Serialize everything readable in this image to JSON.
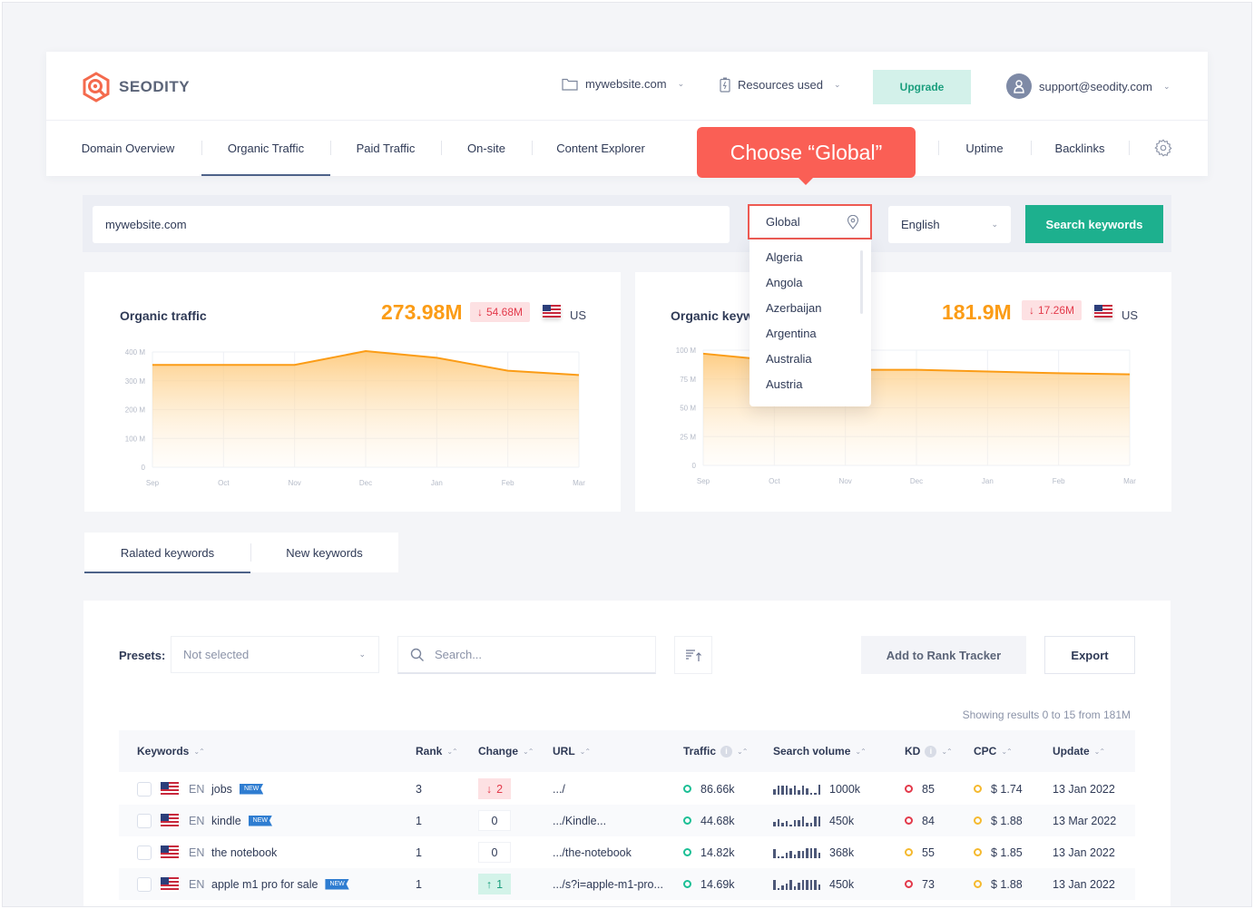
{
  "header": {
    "brand": "SEODITY",
    "project": "mywebsite.com",
    "resources": "Resources used",
    "upgrade": "Upgrade",
    "user_email": "support@seodity.com"
  },
  "nav": {
    "items": [
      {
        "label": "Domain Overview",
        "active": false
      },
      {
        "label": "Organic Traffic",
        "active": true
      },
      {
        "label": "Paid Traffic",
        "active": false
      },
      {
        "label": "On-site",
        "active": false
      },
      {
        "label": "Content Explorer",
        "active": false
      },
      {
        "label": "Uptime",
        "active": false
      },
      {
        "label": "Backlinks",
        "active": false
      }
    ]
  },
  "callout": "Choose “Global”",
  "search": {
    "domain_value": "mywebsite.com",
    "location_value": "Global",
    "language_value": "English",
    "submit_label": "Search keywords",
    "location_options": [
      "Algeria",
      "Angola",
      "Azerbaijan",
      "Argentina",
      "Australia",
      "Austria"
    ]
  },
  "colors": {
    "accent_orange": "#fb9c16",
    "brand_green": "#1db08e",
    "callout_red": "#fa5f55",
    "negative": "#e3394a",
    "positive": "#1a9e7d"
  },
  "chart_data": [
    {
      "type": "area",
      "title": "Organic traffic",
      "summary_value": "273.98M",
      "delta": "54.68M",
      "delta_direction": "down",
      "country": "US",
      "categories": [
        "Sep",
        "Oct",
        "Nov",
        "Dec",
        "Jan",
        "Feb",
        "Mar"
      ],
      "values": [
        355,
        355,
        355,
        403,
        380,
        335,
        320
      ],
      "unit": "M",
      "ylim": [
        0,
        400
      ],
      "yticks": [
        "0",
        "100 M",
        "200 M",
        "300 M",
        "400 M"
      ],
      "grid": true
    },
    {
      "type": "area",
      "title": "Organic keywords",
      "summary_value": "181.9M",
      "delta": "17.26M",
      "delta_direction": "down",
      "country": "US",
      "categories": [
        "Sep",
        "Oct",
        "Nov",
        "Dec",
        "Jan",
        "Feb",
        "Mar"
      ],
      "values": [
        97,
        91,
        83,
        83,
        81.5,
        80,
        79
      ],
      "unit": "M",
      "ylim": [
        0,
        100
      ],
      "yticks": [
        "0",
        "25 M",
        "50 M",
        "75 M",
        "100 M"
      ],
      "grid": true
    }
  ],
  "tabs": [
    {
      "label": "Ralated keywords",
      "active": true
    },
    {
      "label": "New keywords",
      "active": false
    }
  ],
  "table_controls": {
    "presets_label": "Presets:",
    "presets_value": "Not selected",
    "search_placeholder": "Search...",
    "add_rank_tracker": "Add to Rank Tracker",
    "export": "Export",
    "showing": "Showing results 0 to 15 from 181M"
  },
  "table": {
    "columns": [
      "Keywords",
      "Rank",
      "Change",
      "URL",
      "Traffic",
      "Search volume",
      "KD",
      "CPC",
      "Update"
    ],
    "rows": [
      {
        "lang": "EN",
        "keyword": "jobs",
        "is_new": true,
        "new_label": "NEW",
        "rank": "3",
        "change": "2",
        "change_dir": "down",
        "url": ".../",
        "traffic": "86.66k",
        "volume": "1000k",
        "volume_trend": [
          0.5,
          0.8,
          0.8,
          0.8,
          0.6,
          0.8,
          0.4,
          0.8,
          0.6,
          0.2,
          0.2,
          0.9
        ],
        "kd": "85",
        "kd_level": "high",
        "cpc": "$ 1.74",
        "update": "13 Jan 2022"
      },
      {
        "lang": "EN",
        "keyword": "kindle",
        "is_new": true,
        "new_label": "NEW",
        "rank": "1",
        "change": "0",
        "change_dir": "none",
        "url": ".../Kindle...",
        "traffic": "44.68k",
        "volume": "450k",
        "volume_trend": [
          0.4,
          0.7,
          0.3,
          0.5,
          0.2,
          0.6,
          0.6,
          0.9,
          0.3,
          0.3,
          0.9,
          0.9
        ],
        "kd": "84",
        "kd_level": "high",
        "cpc": "$ 1.88",
        "update": "13 Mar 2022"
      },
      {
        "lang": "EN",
        "keyword": "the notebook",
        "is_new": false,
        "new_label": "",
        "rank": "1",
        "change": "0",
        "change_dir": "none",
        "url": ".../the-notebook",
        "traffic": "14.82k",
        "volume": "368k",
        "volume_trend": [
          0.8,
          0.2,
          0.2,
          0.5,
          0.7,
          0.3,
          0.7,
          0.7,
          0.9,
          0.9,
          0.9,
          0.5
        ],
        "kd": "55",
        "kd_level": "medium",
        "cpc": "$ 1.85",
        "update": "13 Jan 2022"
      },
      {
        "lang": "EN",
        "keyword": "apple m1 pro for sale",
        "is_new": true,
        "new_label": "NEW",
        "rank": "1",
        "change": "1",
        "change_dir": "up",
        "url": ".../s?i=apple-m1-pro...",
        "traffic": "14.69k",
        "volume": "450k",
        "volume_trend": [
          0.9,
          0.2,
          0.4,
          0.6,
          0.9,
          0.3,
          0.7,
          0.9,
          0.9,
          0.9,
          0.9,
          0.5
        ],
        "kd": "73",
        "kd_level": "high",
        "cpc": "$ 1.88",
        "update": "13 Jan 2022"
      }
    ]
  }
}
